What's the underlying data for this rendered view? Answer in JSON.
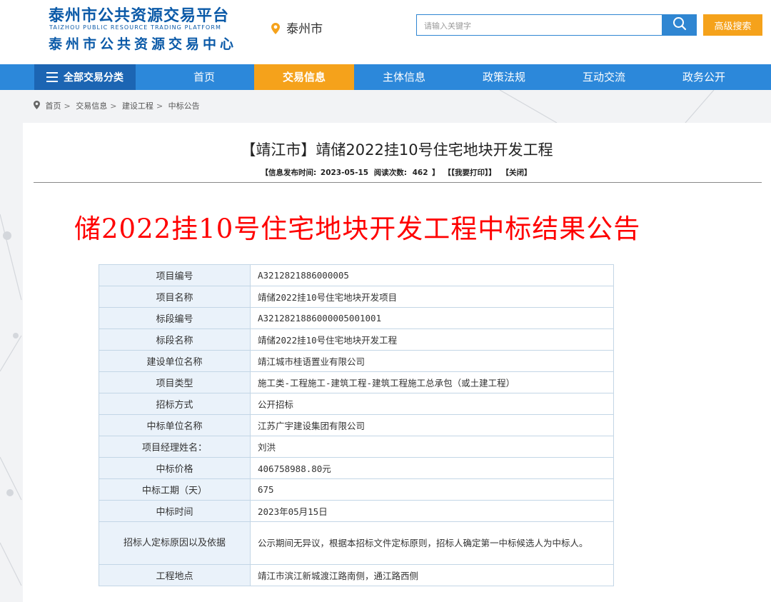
{
  "header": {
    "logo_line1": "泰州市公共资源交易平台",
    "logo_line2": "TAIZHOU PUBLIC RESOURCE TRADING PLATFORM",
    "logo_line3": "泰州市公共资源交易中心",
    "city": "泰州市",
    "search_placeholder": "请输入关键字",
    "search_value": "",
    "advanced_search": "高级搜索"
  },
  "nav": {
    "all_categories": "全部交易分类",
    "items": [
      {
        "label": "首页"
      },
      {
        "label": "交易信息",
        "active": true
      },
      {
        "label": "主体信息"
      },
      {
        "label": "政策法规"
      },
      {
        "label": "互动交流"
      },
      {
        "label": "政务公开"
      }
    ]
  },
  "breadcrumb": [
    "首页",
    "交易信息",
    "建设工程",
    "中标公告"
  ],
  "article": {
    "title": "【靖江市】靖储2022挂10号住宅地块开发工程",
    "meta_publish_label": "【信息发布时间:",
    "meta_publish_date": "2023-05-15",
    "meta_views_label": "阅读次数:",
    "meta_views": "462",
    "meta_views_close": "】",
    "meta_print": "【【我要打印】】",
    "meta_close": "【关闭】",
    "heading": "储2022挂10号住宅地块开发工程中标结果公告",
    "table": [
      {
        "label": "项目编号",
        "value": "A3212821886000005"
      },
      {
        "label": "项目名称",
        "value": "靖储2022挂10号住宅地块开发项目"
      },
      {
        "label": "标段编号",
        "value": "A3212821886000005001001"
      },
      {
        "label": "标段名称",
        "value": "靖储2022挂10号住宅地块开发工程"
      },
      {
        "label": "建设单位名称",
        "value": "靖江城市桂语置业有限公司"
      },
      {
        "label": "项目类型",
        "value": "施工类-工程施工-建筑工程-建筑工程施工总承包（或土建工程）"
      },
      {
        "label": "招标方式",
        "value": "公开招标"
      },
      {
        "label": "中标单位名称",
        "value": "江苏广宇建设集团有限公司"
      },
      {
        "label": "项目经理姓名：",
        "value": "刘洪"
      },
      {
        "label": "中标价格",
        "value": "406758988.80元"
      },
      {
        "label": "中标工期（天）",
        "value": "675"
      },
      {
        "label": "中标时间",
        "value": "2023年05月15日"
      },
      {
        "label": "招标人定标原因以及依据",
        "value": "公示期间无异议，根据本招标文件定标原则，招标人确定第一中标候选人为中标人。"
      },
      {
        "label": "工程地点",
        "value": "靖江市滨江新城渡江路南侧，通江路西侧"
      }
    ]
  },
  "colors": {
    "brand_blue": "#0b5aa8",
    "nav_blue": "#2c88da",
    "accent_orange": "#f5a21b",
    "heading_red": "#ff0000"
  },
  "icons": [
    "location-pin-icon",
    "search-icon",
    "menu-icon"
  ]
}
